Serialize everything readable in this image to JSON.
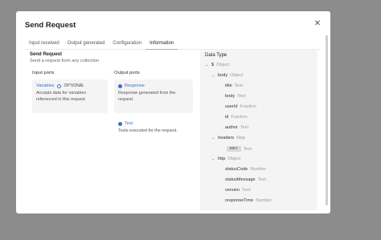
{
  "modal": {
    "title": "Send Request",
    "close_icon": "close-icon"
  },
  "tabs": [
    {
      "label": "Input received",
      "active": false
    },
    {
      "label": "Output generated",
      "active": false
    },
    {
      "label": "Configuration",
      "active": false
    },
    {
      "label": "Information",
      "active": true
    }
  ],
  "info": {
    "title": "Send Request",
    "description": "Send a request from any collection",
    "input_ports_heading": "Input ports",
    "output_ports_heading": "Output ports",
    "input_ports": [
      {
        "name": "Variables",
        "badge": "OPTIONAL",
        "description": "Accepts data for variables referenced in this request"
      }
    ],
    "output_ports": [
      {
        "name": "Response",
        "description": "Response generated from the request."
      },
      {
        "name": "Test",
        "description": "Tests executed for the request."
      }
    ]
  },
  "data_type": {
    "title": "Data Type",
    "rows": [
      {
        "key": "$",
        "type": "Object"
      },
      {
        "key": "body",
        "type": "Object"
      },
      {
        "key": "title",
        "type": "Text"
      },
      {
        "key": "body",
        "type": "Text"
      },
      {
        "key": "userId",
        "type": "Fraction"
      },
      {
        "key": "id",
        "type": "Fraction"
      },
      {
        "key": "author",
        "type": "Text"
      },
      {
        "key": "headers",
        "type": "Map"
      },
      {
        "key": "KEY",
        "type": "Text"
      },
      {
        "key": "http",
        "type": "Object"
      },
      {
        "key": "statusCode",
        "type": "Number"
      },
      {
        "key": "statusMessage",
        "type": "Text"
      },
      {
        "key": "version",
        "type": "Text"
      },
      {
        "key": "responseTime",
        "type": "Number"
      }
    ]
  },
  "colors": {
    "accent": "#f0a070",
    "port": "#3a6fc9",
    "overlay": "#8c8c8c"
  }
}
